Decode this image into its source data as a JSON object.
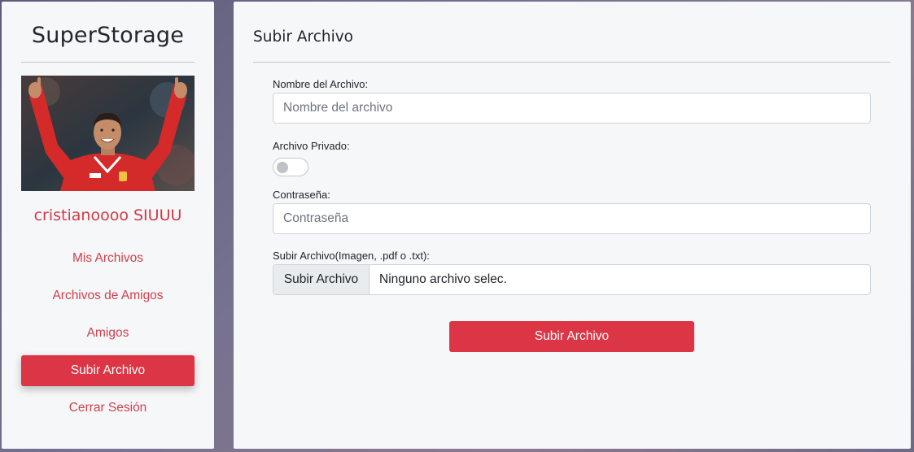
{
  "sidebar": {
    "brand": "SuperStorage",
    "username": "cristianoooo SIUUU",
    "items": [
      {
        "label": "Mis Archivos",
        "active": false
      },
      {
        "label": "Archivos de Amigos",
        "active": false
      },
      {
        "label": "Amigos",
        "active": false
      },
      {
        "label": "Subir Archivo",
        "active": true
      },
      {
        "label": "Cerrar Sesión",
        "active": false
      }
    ]
  },
  "main": {
    "title": "Subir Archivo",
    "form": {
      "name_label": "Nombre del Archivo:",
      "name_placeholder": "Nombre del archivo",
      "private_label": "Archivo Privado:",
      "private_checked": false,
      "password_label": "Contraseña:",
      "password_placeholder": "Contraseña",
      "file_label": "Subir Archivo(Imagen, .pdf o .txt):",
      "file_button": "Subir Archivo",
      "file_status": "Ninguno archivo selec.",
      "submit_label": "Subir Archivo"
    }
  },
  "colors": {
    "accent": "#dc3545",
    "link": "#d0404b",
    "panel": "#f6f7f9"
  }
}
